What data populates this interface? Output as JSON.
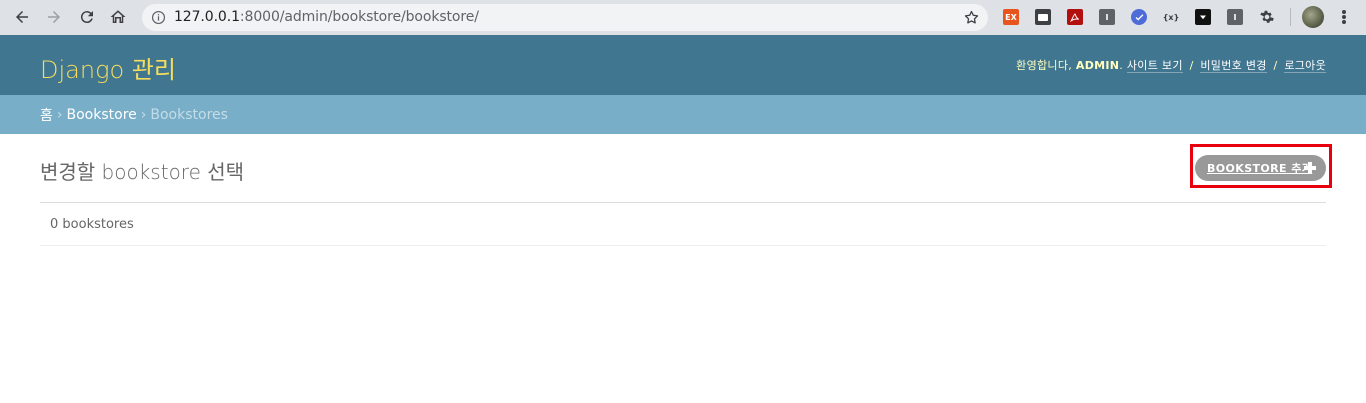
{
  "browser": {
    "url_host": "127.0.0.1",
    "url_path": ":8000/admin/bookstore/bookstore/",
    "icons": [
      "back-arrow-icon",
      "forward-arrow-icon",
      "reload-icon",
      "home-icon",
      "info-icon",
      "bookmark-star-icon"
    ],
    "extensions": [
      {
        "name": "ex-extension-icon",
        "label": "EX",
        "color": "#e8541d"
      },
      {
        "name": "screen-extension-icon",
        "label": "",
        "color": "#3c4043"
      },
      {
        "name": "pdf-extension-icon",
        "label": "",
        "color": "#b40f0f"
      },
      {
        "name": "i-extension-icon-1",
        "label": "I",
        "color": "#5f6368"
      },
      {
        "name": "check-extension-icon",
        "label": "",
        "color": "#4e6cd9"
      },
      {
        "name": "json-extension-icon",
        "label": "{x}",
        "color": "#dee1e6"
      },
      {
        "name": "download-extension-icon",
        "label": "",
        "color": "#111111"
      },
      {
        "name": "i-extension-icon-2",
        "label": "I",
        "color": "#5f6368"
      },
      {
        "name": "gear-extension-icon",
        "label": "",
        "color": "#dee1e6"
      }
    ]
  },
  "header": {
    "brand": "Django 관리",
    "welcome": "환영합니다,",
    "username": "ADMIN",
    "view_site": "사이트 보기",
    "change_password": "비밀번호 변경",
    "logout": "로그아웃",
    "separator": "/"
  },
  "breadcrumbs": {
    "home": "홈",
    "app": "Bookstore",
    "current": "Bookstores",
    "arrow": "›"
  },
  "content": {
    "title": "변경할 bookstore 선택",
    "add_button": "BOOKSTORE 추가",
    "result_count": "0 bookstores"
  },
  "colors": {
    "header_bg": "#417690",
    "brand": "#f5dd5d",
    "breadcrumbs_bg": "#79aec8",
    "add_button_bg": "#999999",
    "highlight": "#e8000d"
  }
}
